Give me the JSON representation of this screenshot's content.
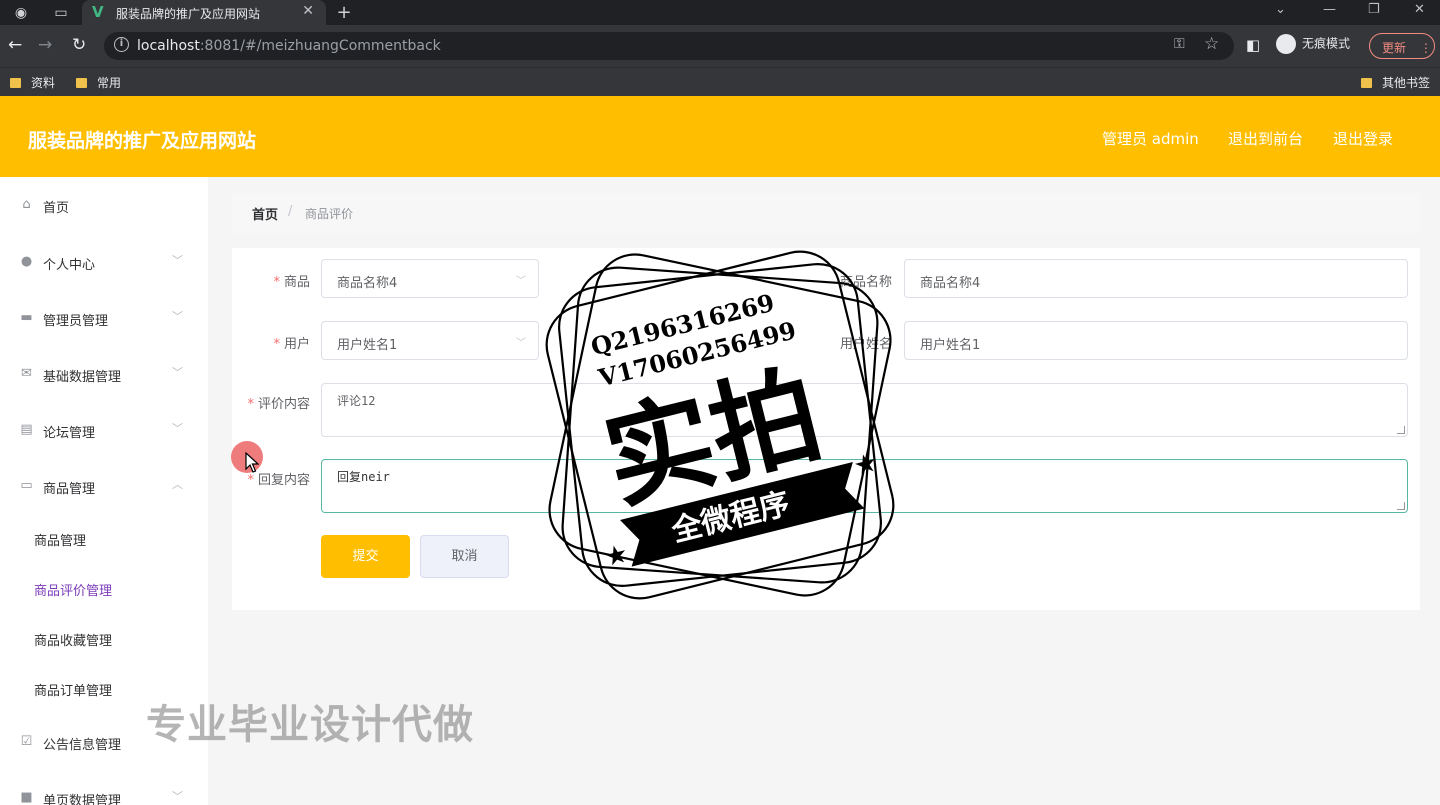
{
  "browser": {
    "tab_title": "服装品牌的推广及应用网站",
    "url_host": "localhost",
    "url_rest": ":8081/#/meizhuangCommentback",
    "profile_label": "无痕模式",
    "update_label": "更新",
    "bookmarks": [
      "资料",
      "常用"
    ],
    "other_bookmarks": "其他书签"
  },
  "header": {
    "site_title": "服装品牌的推广及应用网站",
    "admin_label": "管理员 admin",
    "front_label": "退出到前台",
    "logout_label": "退出登录"
  },
  "sidebar": {
    "items": [
      {
        "label": "首页",
        "icon": "home-icon"
      },
      {
        "label": "个人中心",
        "icon": "user-icon"
      },
      {
        "label": "管理员管理",
        "icon": "briefcase-icon"
      },
      {
        "label": "基础数据管理",
        "icon": "mail-icon"
      },
      {
        "label": "论坛管理",
        "icon": "clipboard-icon"
      },
      {
        "label": "商品管理",
        "icon": "chat-icon"
      }
    ],
    "sub_items": [
      "商品管理",
      "商品评价管理",
      "商品收藏管理",
      "商品订单管理"
    ],
    "more_items": [
      {
        "label": "公告信息管理",
        "icon": "checklist-icon"
      },
      {
        "label": "单页数据管理",
        "icon": "folder-icon"
      }
    ]
  },
  "breadcrumb": {
    "home": "首页",
    "separator": "/",
    "current": "商品评价"
  },
  "form": {
    "product_label": "商品",
    "product_value": "商品名称4",
    "product_name_label": "商品名称",
    "product_name_value": "商品名称4",
    "user_label": "用户",
    "user_value": "用户姓名1",
    "user_name_label": "用户姓名",
    "user_name_value": "用户姓名1",
    "comment_label": "评价内容",
    "comment_value": "评论12",
    "reply_label": "回复内容",
    "reply_value": "回复neir",
    "submit_label": "提交",
    "cancel_label": "取消"
  },
  "overlay": {
    "stamp_line1": "Q2196316269",
    "stamp_line2": "V17060256499",
    "stamp_big": "实拍",
    "stamp_ribbon": "全微程序",
    "watermark": "专业毕业设计代做"
  }
}
